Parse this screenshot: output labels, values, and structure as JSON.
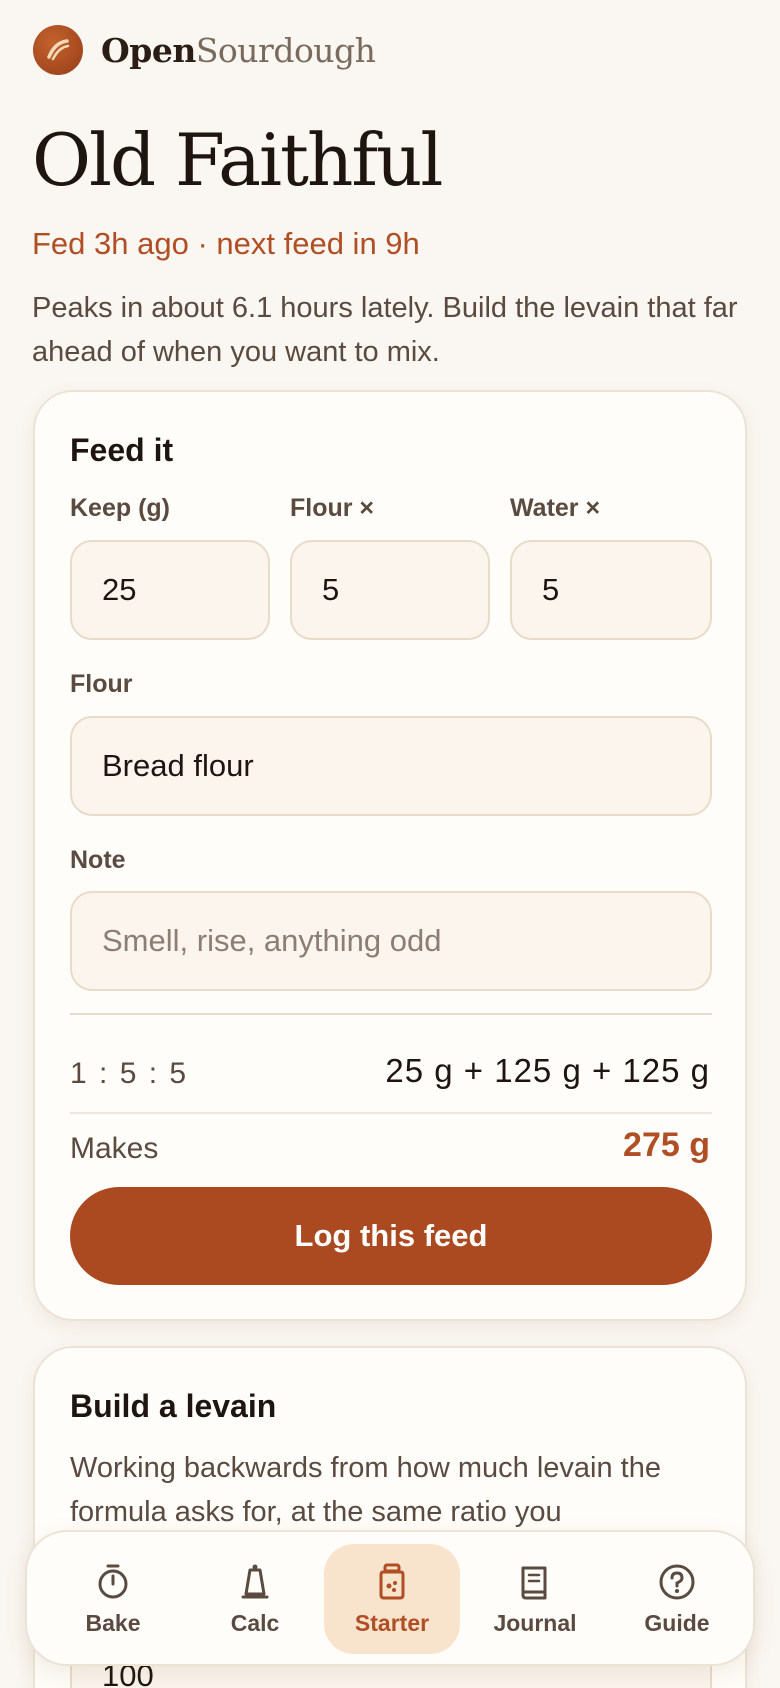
{
  "brand": {
    "name_part1": "Open",
    "name_part2": "Sourdough",
    "logo_icon": "bread-loaf-icon"
  },
  "starter": {
    "name": "Old Faithful",
    "status": "Fed 3h ago · next feed in 9h",
    "description": "Peaks in about 6.1 hours lately. Build the levain that far ahead of when you want to mix."
  },
  "feed_card": {
    "title": "Feed it",
    "keep_label": "Keep (g)",
    "keep_value": "25",
    "flour_ratio_label": "Flour ×",
    "flour_ratio_value": "5",
    "water_ratio_label": "Water ×",
    "water_ratio_value": "5",
    "flour_label": "Flour",
    "flour_value": "Bread flour",
    "note_label": "Note",
    "note_placeholder": "Smell, rise, anything odd",
    "ratio_text": "1 : 5 : 5",
    "amounts_text": "25 g + 125 g + 125 g",
    "makes_label": "Makes",
    "makes_value": "275 g",
    "log_button": "Log this feed"
  },
  "levain_card": {
    "title": "Build a levain",
    "description": "Working backwards from how much levain the formula asks for, at the same ratio you",
    "input_value": "100"
  },
  "tabbar": {
    "tabs": [
      {
        "label": "Bake",
        "icon": "timer-icon"
      },
      {
        "label": "Calc",
        "icon": "scale-icon"
      },
      {
        "label": "Starter",
        "icon": "jar-icon",
        "active": true
      },
      {
        "label": "Journal",
        "icon": "book-icon"
      },
      {
        "label": "Guide",
        "icon": "help-icon"
      }
    ]
  },
  "colors": {
    "accent": "#ab4920",
    "accent_text": "#b04e24",
    "active_tab_bg": "#f8e3cc",
    "background": "#faf6f1"
  }
}
